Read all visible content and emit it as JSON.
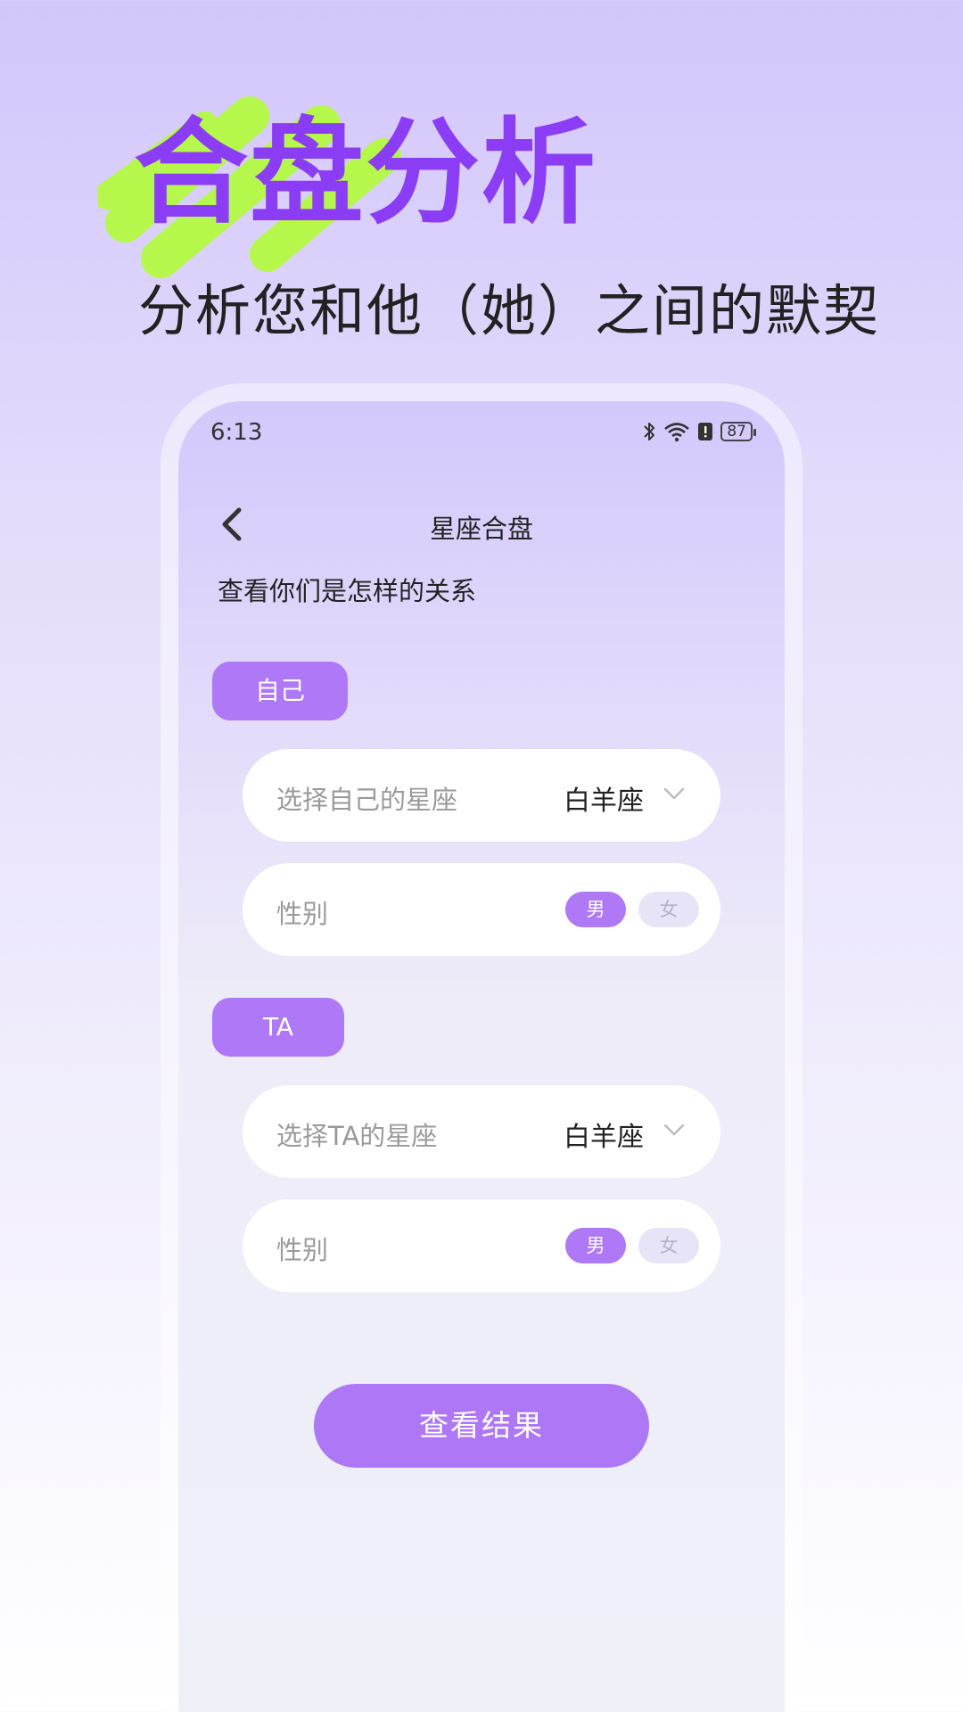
{
  "promo": {
    "title": "合盘分析",
    "subtitle": "分析您和他（她）之间的默契"
  },
  "status_bar": {
    "time": "6:13",
    "battery": "87",
    "icons": [
      "bluetooth-icon",
      "wifi-icon",
      "alert-icon",
      "battery-icon"
    ]
  },
  "nav": {
    "title": "星座合盘",
    "back_icon": "chevron-left-icon"
  },
  "description": "查看你们是怎样的关系",
  "self": {
    "chip_label": "自己",
    "sign_label": "选择自己的星座",
    "sign_value": "白羊座",
    "gender_label": "性别",
    "gender_male": "男",
    "gender_female": "女",
    "gender_selected": "男"
  },
  "partner": {
    "chip_label": "TA",
    "sign_label": "选择TA的星座",
    "sign_value": "白羊座",
    "gender_label": "性别",
    "gender_male": "男",
    "gender_female": "女",
    "gender_selected": "男"
  },
  "submit_label": "查看结果",
  "colors": {
    "accent": "#ae78f6",
    "title_purple": "#8b3df5",
    "brush_green": "#b5f74a"
  }
}
